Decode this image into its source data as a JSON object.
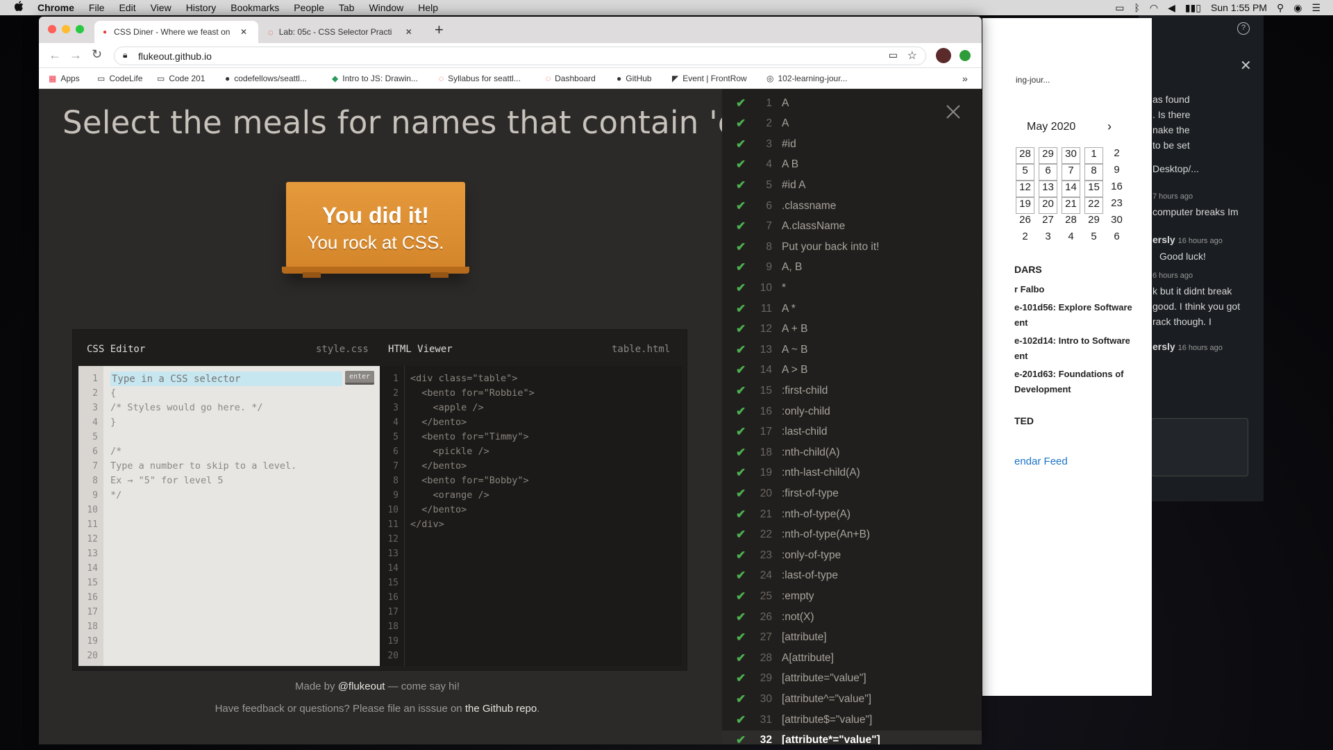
{
  "menubar": {
    "app": "Chrome",
    "items": [
      "File",
      "Edit",
      "View",
      "History",
      "Bookmarks",
      "People",
      "Tab",
      "Window",
      "Help"
    ],
    "clock": "Sun 1:55 PM"
  },
  "tabs": [
    {
      "title": "CSS Diner - Where we feast on",
      "active": true
    },
    {
      "title": "Lab: 05c - CSS Selector Practi",
      "active": false
    }
  ],
  "address": "flukeout.github.io",
  "bookmarks": [
    "Apps",
    "CodeLife",
    "Code 201",
    "codefellows/seattl...",
    "Intro to JS: Drawin...",
    "Syllabus for seattl...",
    "Dashboard",
    "GitHub",
    "Event | FrontRow",
    "102-learning-jour..."
  ],
  "headline": "Select the meals for names that contain 'obb'",
  "success": {
    "line1": "You did it!",
    "line2": "You rock at CSS."
  },
  "editor": {
    "css_title": "CSS Editor",
    "css_file": "style.css",
    "html_title": "HTML Viewer",
    "html_file": "table.html",
    "input_placeholder": "Type in a CSS selector",
    "enter_label": "enter",
    "css_lines": [
      "",
      "{",
      "/* Styles would go here. */",
      "}",
      "",
      "/*",
      "Type a number to skip to a level.",
      "Ex → \"5\" for level 5",
      "*/"
    ],
    "html_lines": [
      "<div class=\"table\">",
      "  <bento for=\"Robbie\">",
      "    <apple />",
      "  </bento>",
      "  <bento for=\"Timmy\">",
      "    <pickle />",
      "  </bento>",
      "  <bento for=\"Bobby\">",
      "    <orange />",
      "  </bento>",
      "</div>"
    ],
    "line_numbers": [
      "1",
      "2",
      "3",
      "4",
      "5",
      "6",
      "7",
      "8",
      "9",
      "10",
      "11",
      "12",
      "13",
      "14",
      "15",
      "16",
      "17",
      "18",
      "19",
      "20"
    ]
  },
  "footer": {
    "made_by_prefix": "Made by ",
    "made_by_link": "@flukeout",
    "made_by_suffix": " — come say hi!",
    "feedback_prefix": "Have feedback or questions? Please file an isssue on ",
    "feedback_link": "the Github repo",
    "feedback_suffix": "."
  },
  "levels": [
    "A",
    "A",
    "#id",
    "A B",
    "#id A",
    ".classname",
    "A.className",
    "Put your back into it!",
    "A, B",
    "*",
    "A *",
    "A + B",
    "A ~ B",
    "A > B",
    ":first-child",
    ":only-child",
    ":last-child",
    ":nth-child(A)",
    ":nth-last-child(A)",
    ":first-of-type",
    ":nth-of-type(A)",
    ":nth-of-type(An+B)",
    ":only-of-type",
    ":last-of-type",
    ":empty",
    ":not(X)",
    "[attribute]",
    "A[attribute]",
    "[attribute=\"value\"]",
    "[attribute^=\"value\"]",
    "[attribute$=\"value\"]",
    "[attribute*=\"value\"]"
  ],
  "current_level": 32,
  "calendar": {
    "month": "May 2020",
    "rows": [
      [
        "28",
        "29",
        "30",
        "1",
        "2"
      ],
      [
        "5",
        "6",
        "7",
        "8",
        "9"
      ],
      [
        "12",
        "13",
        "14",
        "15",
        "16"
      ],
      [
        "19",
        "20",
        "21",
        "22",
        "23"
      ],
      [
        "26",
        "27",
        "28",
        "29",
        "30"
      ],
      [
        "2",
        "3",
        "4",
        "5",
        "6"
      ]
    ],
    "section": "DARS",
    "entries": [
      "r Falbo",
      "e-101d56: Explore Software",
      "ent",
      "e-102d14: Intro to Software",
      "ent",
      "e-201d63: Foundations of",
      "Development"
    ],
    "section2": "TED",
    "feed_link": "endar Feed",
    "bookmark_frag": "ing-jour..."
  },
  "slack": {
    "lines": [
      "as found",
      ". Is there",
      "nake the",
      "to be set",
      "Desktop/...",
      "7 hours ago",
      "computer breaks Im",
      "ersly",
      "16 hours ago",
      "Good luck!",
      "6 hours ago",
      "k but it didnt break",
      "good. I think you got",
      "rack though. I",
      "ersly",
      "16 hours ago"
    ]
  }
}
